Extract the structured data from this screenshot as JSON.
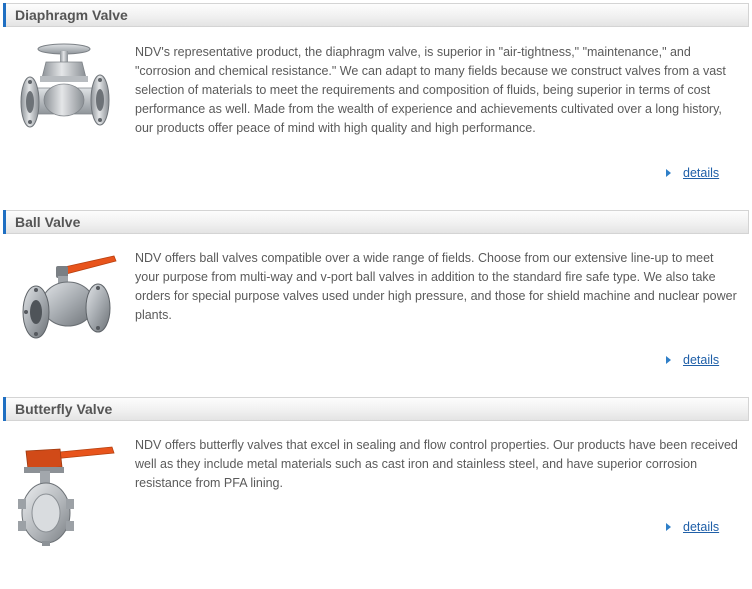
{
  "sections": [
    {
      "title": "Diaphragm Valve",
      "image": "diaphragm-valve-photo",
      "description": "NDV's representative product, the diaphragm valve, is superior in \"air-tightness,\" \"maintenance,\" and \"corrosion and chemical resistance.\" We can adapt to many fields because we construct valves from a vast selection of materials to meet the requirements and composition of fluids, being superior in terms of cost performance as well. Made from the wealth of experience and achievements cultivated over a long history, our products offer peace of mind with high quality and high performance.",
      "link_label": "details",
      "link_icon": "arrow-right-icon"
    },
    {
      "title": "Ball Valve",
      "image": "ball-valve-photo",
      "description": "NDV offers ball valves compatible over a wide range of fields. Choose from our extensive line-up to meet your purpose from multi-way and v-port ball valves in addition to the standard fire safe type. We also take orders for special purpose valves used under high pressure, and those for shield machine and nuclear power plants.",
      "link_label": "details",
      "link_icon": "arrow-right-icon"
    },
    {
      "title": "Butterfly Valve",
      "image": "butterfly-valve-photo",
      "description": "NDV offers butterfly valves that excel in sealing and flow control properties. Our products have been received well as they include metal materials such as cast iron and stainless steel, and have superior corrosion resistance from PFA lining.",
      "link_label": "details",
      "link_icon": "arrow-right-icon"
    }
  ],
  "colors": {
    "accent_bar": "#1f6fc2",
    "link": "#1f5fa8",
    "handle": "#e8541c",
    "body_text": "#5a5a5a"
  }
}
